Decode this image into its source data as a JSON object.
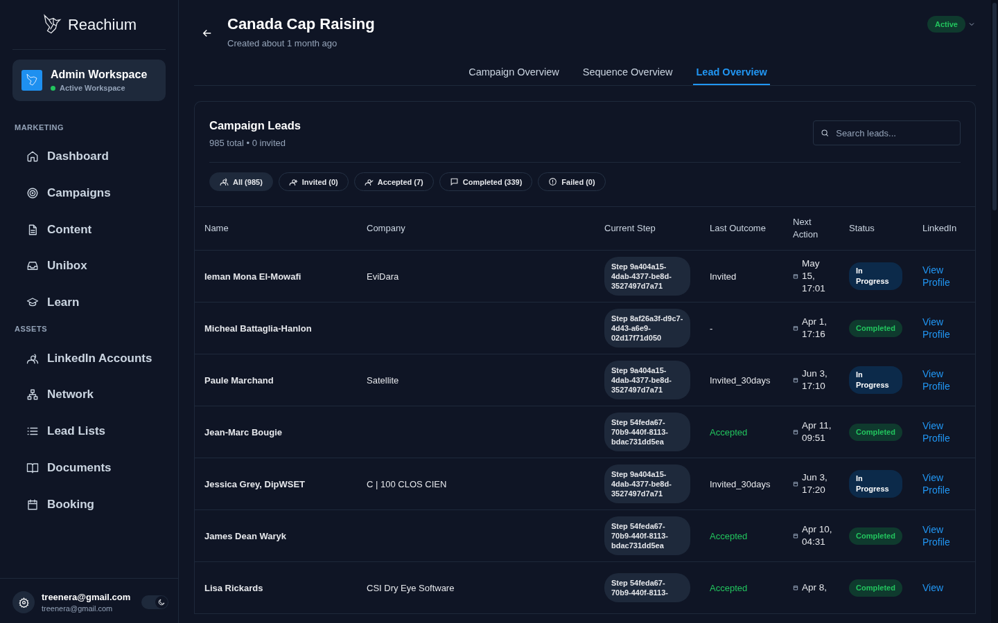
{
  "brand": {
    "name": "Reachium"
  },
  "workspace": {
    "name": "Admin Workspace",
    "status": "Active Workspace"
  },
  "nav_sections": [
    {
      "title": "MARKETING",
      "items": [
        {
          "label": "Dashboard"
        },
        {
          "label": "Campaigns"
        },
        {
          "label": "Content"
        },
        {
          "label": "Unibox"
        },
        {
          "label": "Learn"
        }
      ]
    },
    {
      "title": "ASSETS",
      "items": [
        {
          "label": "LinkedIn Accounts"
        },
        {
          "label": "Network"
        },
        {
          "label": "Lead Lists"
        },
        {
          "label": "Documents"
        },
        {
          "label": "Booking"
        }
      ]
    }
  ],
  "user": {
    "name": "treenera@gmail.com",
    "email": "treenera@gmail.com",
    "dark_mode": true
  },
  "header": {
    "title": "Canada Cap Raising",
    "subtitle": "Created about 1 month ago",
    "status": "Active"
  },
  "tabs": [
    {
      "label": "Campaign Overview",
      "selected": false
    },
    {
      "label": "Sequence Overview",
      "selected": false
    },
    {
      "label": "Lead Overview",
      "selected": true
    }
  ],
  "leads": {
    "title": "Campaign Leads",
    "summary": "985 total • 0 invited",
    "search": {
      "placeholder": "Search leads..."
    },
    "filters": [
      {
        "label": "All (985)",
        "selected": true
      },
      {
        "label": "Invited (0)",
        "selected": false
      },
      {
        "label": "Accepted (7)",
        "selected": false
      },
      {
        "label": "Completed (339)",
        "selected": false
      },
      {
        "label": "Failed (0)",
        "selected": false
      }
    ],
    "columns": [
      "Name",
      "Company",
      "Current Step",
      "Last Outcome",
      "Next Action",
      "Status",
      "LinkedIn"
    ],
    "rows": [
      {
        "name": "Ieman Mona El-Mowafi",
        "company": "EviDara",
        "step": "Step 9a404a15-4dab-4377-be8d-3527497d7a71",
        "outcome": "Invited",
        "outcome_accepted": false,
        "next": "May 15, 17:01",
        "status": "In Progress",
        "status_completed": false,
        "link": "View Profile"
      },
      {
        "name": "Micheal Battaglia-Hanlon",
        "company": "",
        "step": "Step 8af26a3f-d9c7-4d43-a6e9-02d17f71d050",
        "outcome": "-",
        "outcome_accepted": false,
        "next": "Apr 1, 17:16",
        "status": "Completed",
        "status_completed": true,
        "link": "View Profile"
      },
      {
        "name": "Paule Marchand",
        "company": "Satellite",
        "step": "Step 9a404a15-4dab-4377-be8d-3527497d7a71",
        "outcome": "Invited_30days",
        "outcome_accepted": false,
        "next": "Jun 3, 17:10",
        "status": "In Progress",
        "status_completed": false,
        "link": "View Profile"
      },
      {
        "name": "Jean-Marc Bougie",
        "company": "",
        "step": "Step 54feda67-70b9-440f-8113-bdac731dd5ea",
        "outcome": "Accepted",
        "outcome_accepted": true,
        "next": "Apr 11, 09:51",
        "status": "Completed",
        "status_completed": true,
        "link": "View Profile"
      },
      {
        "name": "Jessica Grey, DipWSET",
        "company": "C | 100 CLOS CIEN",
        "step": "Step 9a404a15-4dab-4377-be8d-3527497d7a71",
        "outcome": "Invited_30days",
        "outcome_accepted": false,
        "next": "Jun 3, 17:20",
        "status": "In Progress",
        "status_completed": false,
        "link": "View Profile"
      },
      {
        "name": "James Dean Waryk",
        "company": "",
        "step": "Step 54feda67-70b9-440f-8113-bdac731dd5ea",
        "outcome": "Accepted",
        "outcome_accepted": true,
        "next": "Apr 10, 04:31",
        "status": "Completed",
        "status_completed": true,
        "link": "View Profile"
      },
      {
        "name": "Lisa Rickards",
        "company": "CSI Dry Eye Software",
        "step": "Step 54feda67-70b9-440f-8113-",
        "outcome": "Accepted",
        "outcome_accepted": true,
        "next": "Apr 8,",
        "status": "Completed",
        "status_completed": true,
        "link": "View"
      }
    ]
  }
}
